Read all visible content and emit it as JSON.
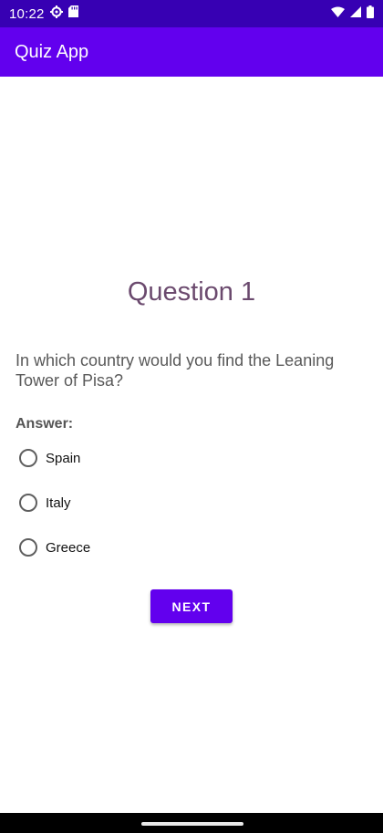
{
  "status_bar": {
    "time": "10:22",
    "icons": [
      "settings-icon",
      "sd-card-icon",
      "wifi-icon",
      "signal-icon",
      "battery-icon"
    ],
    "colors": {
      "background": "#3700B3"
    }
  },
  "app_bar": {
    "title": "Quiz App",
    "colors": {
      "background": "#6200EE"
    }
  },
  "quiz": {
    "question_title": "Question 1",
    "question_text": "In which country would you find the Leaning Tower of Pisa?",
    "answer_label": "Answer:",
    "options": [
      {
        "label": "Spain",
        "selected": false
      },
      {
        "label": "Italy",
        "selected": false
      },
      {
        "label": "Greece",
        "selected": false
      }
    ],
    "next_label": "NEXT"
  },
  "nav_bar": {
    "icons": [
      "home-handle"
    ]
  }
}
